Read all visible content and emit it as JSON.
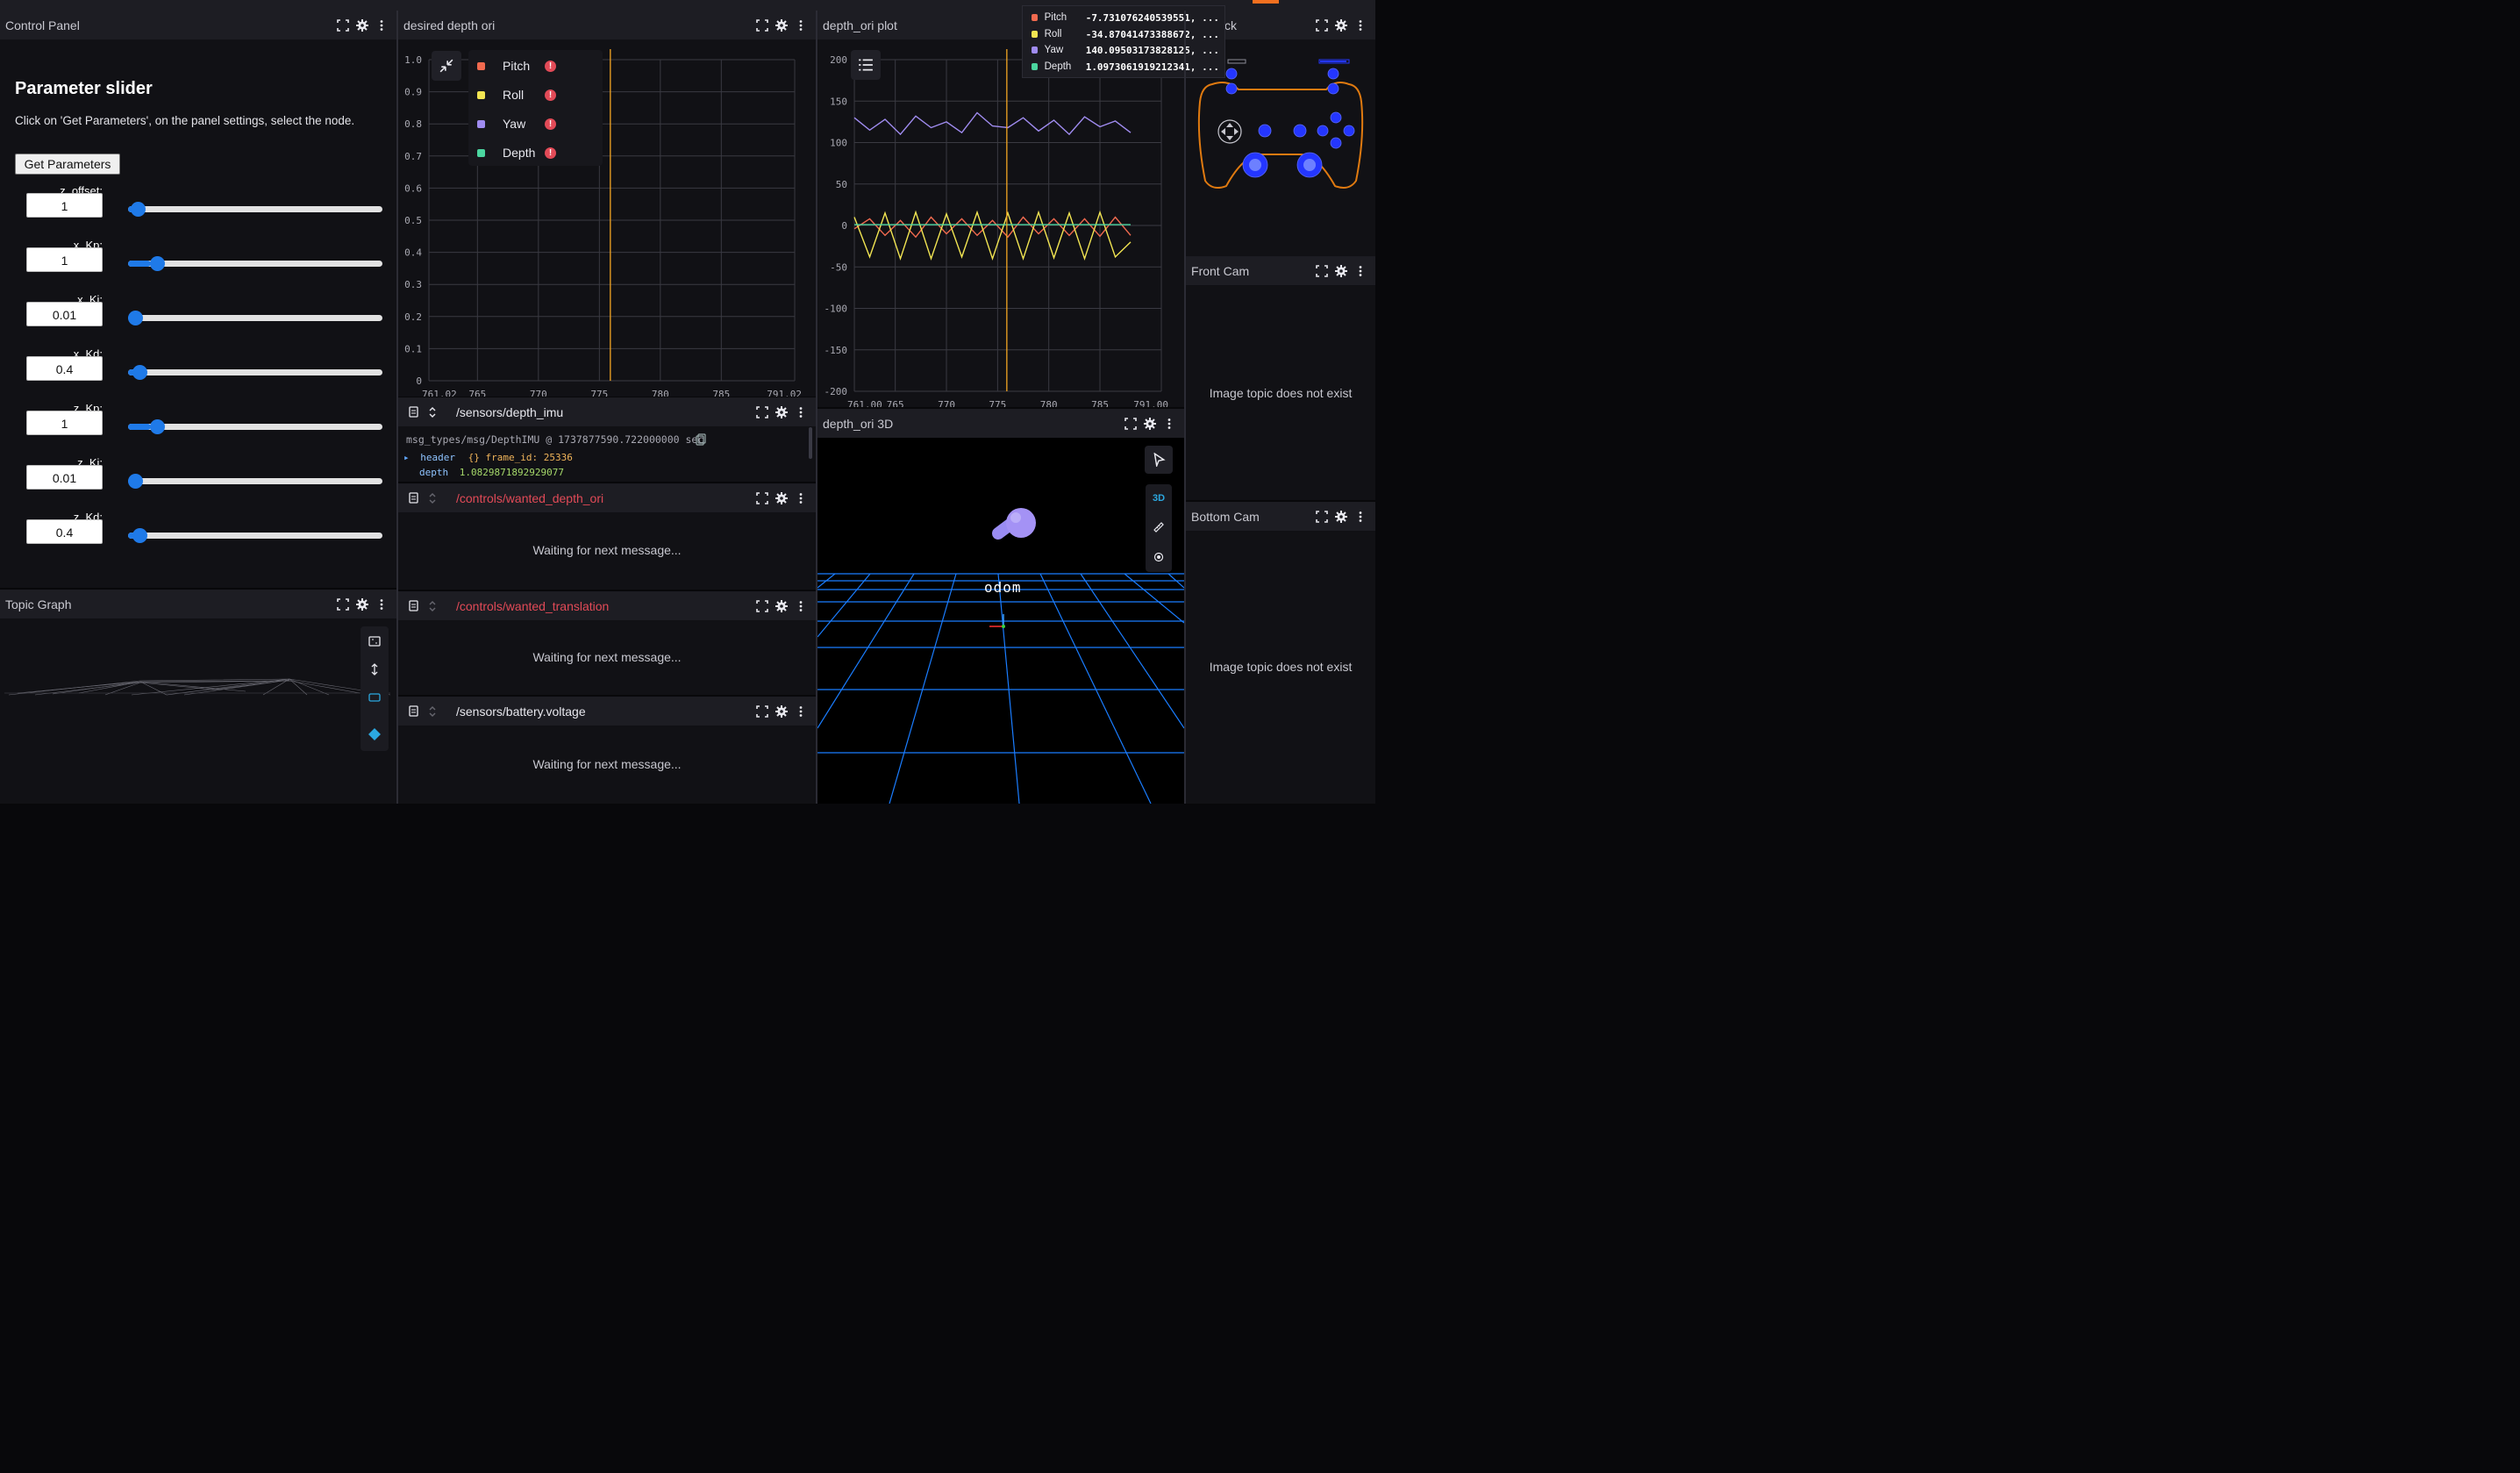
{
  "colors": {
    "pitch": "#f16a4f",
    "roll": "#f2e552",
    "yaw": "#a08cf0",
    "depth": "#4bd6a0",
    "accent_blue": "#1f7ae8",
    "time_cursor": "#f4a623",
    "error_red": "#e24a57"
  },
  "control_panel": {
    "title": "Control Panel",
    "heading": "Parameter slider",
    "description": "Click on 'Get Parameters', on the panel settings, select the node.",
    "get_button": "Get Parameters",
    "params": [
      {
        "label": "z_offset:",
        "value": "1",
        "slider_fraction": 0.01
      },
      {
        "label": "x_Kp:",
        "value": "1",
        "slider_fraction": 0.09
      },
      {
        "label": "x_Ki:",
        "value": "0.01",
        "slider_fraction": 0.0
      },
      {
        "label": "x_Kd:",
        "value": "0.4",
        "slider_fraction": 0.02
      },
      {
        "label": "z_Kp:",
        "value": "1",
        "slider_fraction": 0.09
      },
      {
        "label": "z_Ki:",
        "value": "0.01",
        "slider_fraction": 0.0
      },
      {
        "label": "z_Kd:",
        "value": "0.4",
        "slider_fraction": 0.02
      }
    ]
  },
  "topic_graph": {
    "title": "Topic Graph"
  },
  "desired_plot": {
    "title": "desired depth ori",
    "legend": [
      "Pitch",
      "Roll",
      "Yaw",
      "Depth"
    ],
    "warn_glyph": "!"
  },
  "depth_ori_plot": {
    "title": "depth_ori plot"
  },
  "tooltip": {
    "rows": [
      {
        "name": "Pitch",
        "value": "-7.731076240539551, ..."
      },
      {
        "name": "Roll",
        "value": "-34.87041473388672, ..."
      },
      {
        "name": "Yaw",
        "value": "140.09503173828125, ..."
      },
      {
        "name": "Depth",
        "value": "1.0973061919212341, ..."
      }
    ]
  },
  "joystick": {
    "title_suffix": "ck"
  },
  "front_cam": {
    "title": "Front Cam",
    "message": "Image topic does not exist"
  },
  "bottom_cam": {
    "title": "Bottom Cam",
    "message": "Image topic does not exist"
  },
  "depth_imu": {
    "topic": "/sensors/depth_imu",
    "meta": "msg_types/msg/DepthIMU @ 1737877590.722000000 sec",
    "header_key": "header",
    "header_val": "{} frame_id: 25336",
    "depth_key": "depth",
    "depth_val": "1.0829871892929077"
  },
  "wanted_depth_ori": {
    "topic": "/controls/wanted_depth_ori",
    "waiting": "Waiting for next message..."
  },
  "wanted_translation": {
    "topic": "/controls/wanted_translation",
    "waiting": "Waiting for next message..."
  },
  "battery": {
    "topic": "/sensors/battery.voltage",
    "waiting": "Waiting for next message..."
  },
  "depth_ori_3d": {
    "title": "depth_ori 3D",
    "mode_3d": "3D",
    "frame_label": "odom"
  },
  "chart_data": [
    {
      "type": "line",
      "title": "desired depth ori",
      "x_ticks": [
        "761.02",
        "765",
        "770",
        "775",
        "780",
        "785",
        "791.02"
      ],
      "y_ticks": [
        "1.0",
        "0.9",
        "0.8",
        "0.7",
        "0.6",
        "0.5",
        "0.4",
        "0.3",
        "0.2",
        "0.1",
        "0"
      ],
      "xlim": [
        761.02,
        791.02
      ],
      "ylim": [
        0,
        1.0
      ],
      "time_cursor": 775.9,
      "series": [
        {
          "name": "Pitch",
          "values": []
        },
        {
          "name": "Roll",
          "values": []
        },
        {
          "name": "Yaw",
          "values": []
        },
        {
          "name": "Depth",
          "values": []
        }
      ],
      "grid": true,
      "legend_position": "top-left"
    },
    {
      "type": "line",
      "title": "depth_ori plot",
      "x_ticks": [
        "761.00",
        "765",
        "770",
        "775",
        "780",
        "785",
        "791.00"
      ],
      "y_ticks": [
        "200",
        "150",
        "100",
        "50",
        "0",
        "-50",
        "-100",
        "-150",
        "-200"
      ],
      "xlim": [
        761.0,
        791.0
      ],
      "ylim": [
        -200,
        200
      ],
      "time_cursor": 775.9,
      "grid": true,
      "series": [
        {
          "name": "Yaw",
          "x": [
            761.0,
            762.5,
            764.0,
            765.5,
            767.0,
            768.5,
            770.0,
            771.5,
            773.0,
            774.5,
            776.0,
            777.5,
            779.0,
            780.5,
            782.0,
            783.5,
            785.0,
            786.5,
            788.0
          ],
          "values": [
            130,
            115,
            128,
            110,
            132,
            118,
            125,
            112,
            136,
            120,
            118,
            130,
            114,
            127,
            110,
            131,
            119,
            126,
            112
          ]
        },
        {
          "name": "Pitch",
          "x": [
            761.0,
            762.5,
            764.0,
            765.5,
            767.0,
            768.5,
            770.0,
            771.5,
            773.0,
            774.5,
            776.0,
            777.5,
            779.0,
            780.5,
            782.0,
            783.5,
            785.0,
            786.5,
            788.0
          ],
          "values": [
            -4,
            8,
            -12,
            6,
            -14,
            10,
            -10,
            8,
            -12,
            6,
            -14,
            10,
            -10,
            8,
            -12,
            8,
            -13,
            10,
            -12
          ]
        },
        {
          "name": "Roll",
          "x": [
            761.0,
            762.5,
            764.0,
            765.5,
            767.0,
            768.5,
            770.0,
            771.5,
            773.0,
            774.5,
            776.0,
            777.5,
            779.0,
            780.5,
            782.0,
            783.5,
            785.0,
            786.5,
            788.0
          ],
          "values": [
            10,
            -38,
            15,
            -40,
            16,
            -40,
            14,
            -38,
            16,
            -40,
            15,
            -40,
            16,
            -39,
            15,
            -40,
            16,
            -38,
            -20
          ]
        },
        {
          "name": "Depth",
          "x": [
            761.0,
            788.0
          ],
          "values": [
            1,
            1
          ]
        }
      ]
    }
  ]
}
